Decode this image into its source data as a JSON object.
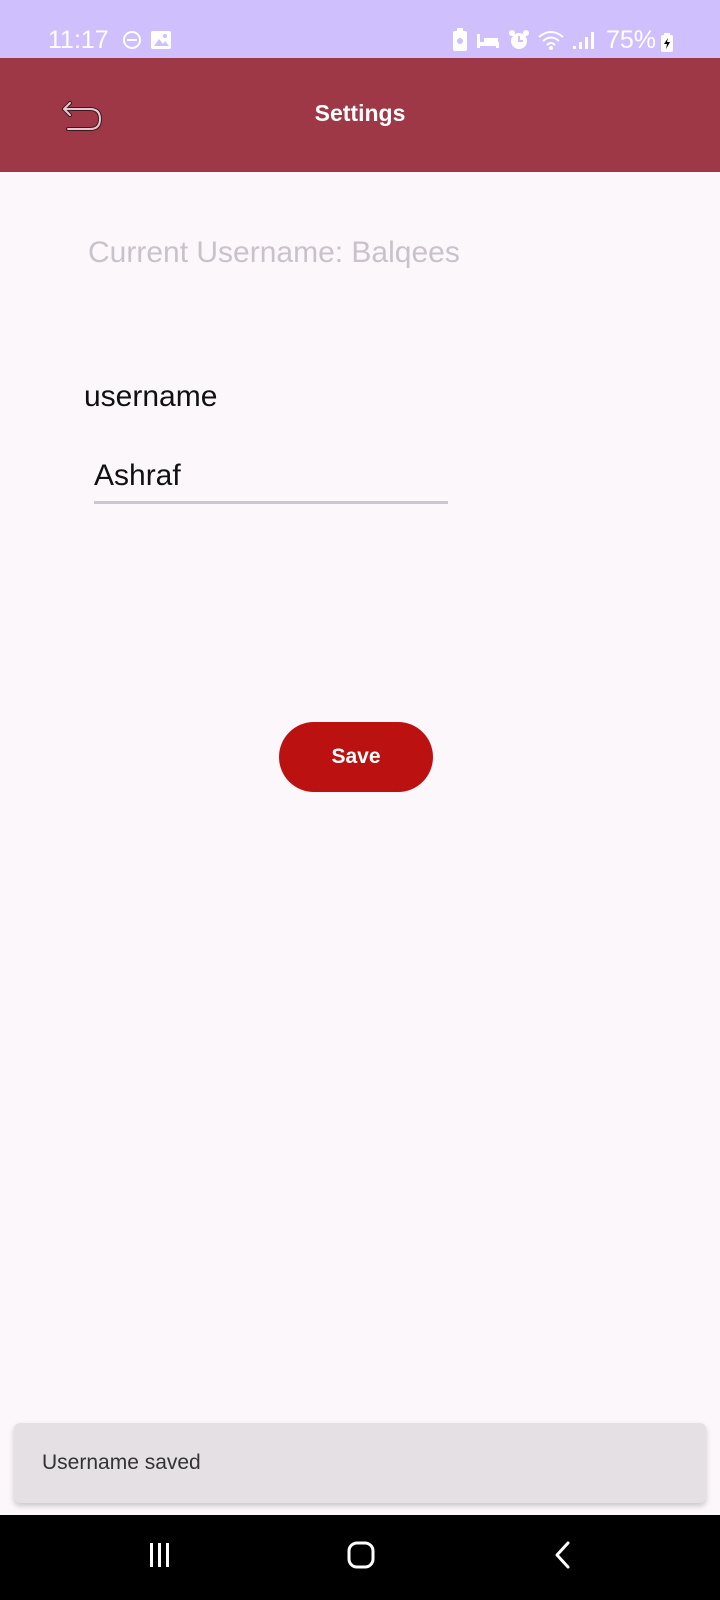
{
  "status_bar": {
    "time": "11:17",
    "battery": "75%",
    "left_icons": [
      "do-not-disturb-icon",
      "image-icon"
    ],
    "right_icons": [
      "battery-saver-icon",
      "sleep-icon",
      "alarm-icon",
      "wifi-icon",
      "signal-icon"
    ]
  },
  "app_bar": {
    "title": "Settings",
    "back_icon": "back-arrow-icon"
  },
  "main": {
    "current_username": "Current Username: Balqees",
    "field_label": "username",
    "username_value": "Ashraf",
    "save_label": "Save"
  },
  "snackbar": {
    "message": "Username saved"
  },
  "nav_bar": {
    "buttons": [
      "recents-icon",
      "home-icon",
      "back-icon"
    ]
  },
  "colors": {
    "status_bar": "#cfc0fd",
    "app_bar": "#9e3846",
    "save_button": "#bb1111",
    "background": "#fcf7fb"
  }
}
